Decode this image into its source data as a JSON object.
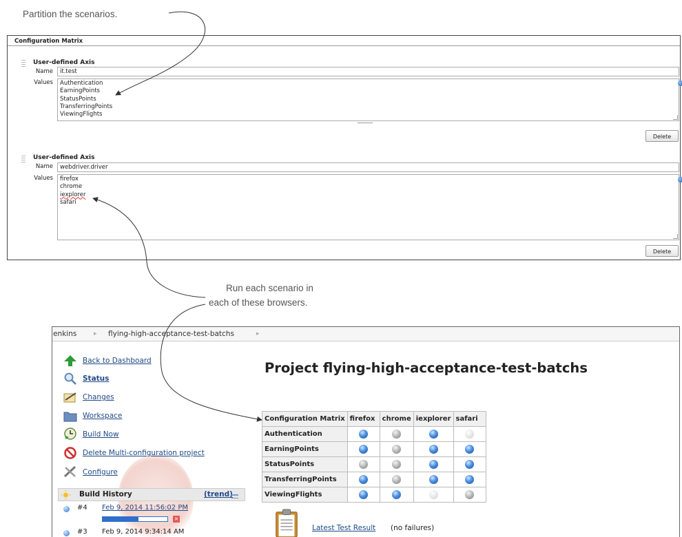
{
  "callouts": {
    "partition": "Partition the scenarios.",
    "run_each_line1": "Run each scenario in",
    "run_each_line2": "each of these browsers."
  },
  "config_matrix": {
    "title": "Configuration Matrix",
    "axes": [
      {
        "title": "User-defined Axis",
        "name_label": "Name",
        "name_value": "it.test",
        "values_label": "Values",
        "values": [
          "Authentication",
          "EarningPoints",
          "StatusPoints",
          "TransferringPoints",
          "ViewingFlights"
        ],
        "delete_label": "Delete"
      },
      {
        "title": "User-defined Axis",
        "name_label": "Name",
        "name_value": "webdriver.driver",
        "values_label": "Values",
        "values": [
          "firefox",
          "chrome",
          "iexplorer",
          "safari"
        ],
        "delete_label": "Delete"
      }
    ]
  },
  "jenkins": {
    "breadcrumbs": [
      "Jenkins",
      "flying-high-acceptance-test-batchs"
    ],
    "sidebar": [
      {
        "label": "Back to Dashboard",
        "icon": "up-arrow-icon"
      },
      {
        "label": "Status",
        "icon": "magnifier-icon"
      },
      {
        "label": "Changes",
        "icon": "notepad-icon"
      },
      {
        "label": "Workspace",
        "icon": "folder-icon"
      },
      {
        "label": "Build Now",
        "icon": "clock-icon"
      },
      {
        "label": "Delete Multi-configuration project",
        "icon": "no-entry-icon"
      },
      {
        "label": "Configure",
        "icon": "tools-icon"
      }
    ],
    "build_history": {
      "title": "Build History",
      "trend_label": "(trend)",
      "builds": [
        {
          "number": "#4",
          "date": "Feb 9, 2014 11:56:02 PM",
          "progress": 0.55
        },
        {
          "number": "#3",
          "date": "Feb 9, 2014 9:34:14 AM"
        }
      ]
    },
    "page_title": "Project flying-high-acceptance-test-batchs",
    "matrix": {
      "corner": "Configuration Matrix",
      "columns": [
        "firefox",
        "chrome",
        "iexplorer",
        "safari"
      ],
      "rows": [
        {
          "name": "Authentication",
          "status": [
            "blue",
            "grey",
            "blue",
            "disabled"
          ]
        },
        {
          "name": "EarningPoints",
          "status": [
            "blue",
            "grey",
            "blue",
            "blue"
          ]
        },
        {
          "name": "StatusPoints",
          "status": [
            "grey",
            "grey",
            "blue",
            "blue"
          ]
        },
        {
          "name": "TransferringPoints",
          "status": [
            "blue",
            "grey",
            "blue",
            "blue"
          ]
        },
        {
          "name": "ViewingFlights",
          "status": [
            "blue",
            "blue",
            "disabled",
            "grey"
          ]
        }
      ]
    },
    "latest_test": {
      "label": "Latest Test Result",
      "note": "(no failures)"
    },
    "colors": {
      "blue": "#2f6fcc",
      "grey": "#9a9a9a",
      "disabled": "#dcdcdc",
      "link": "#204a87"
    }
  }
}
